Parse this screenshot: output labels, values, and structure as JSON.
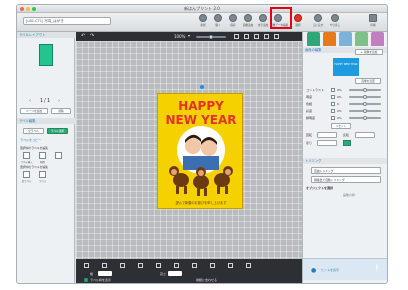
{
  "window": {
    "title": "新はんプリント 2.0",
    "document_name": "[LB1-CT1] 写真_はがき"
  },
  "toolbar": {
    "buttons": [
      {
        "label": "新規"
      },
      {
        "label": "開く"
      },
      {
        "label": "保存"
      },
      {
        "label": "画像追加"
      },
      {
        "label": "文字追加"
      },
      {
        "label": "画像データ編集"
      },
      {
        "label": "選択"
      },
      {
        "label": "元に戻す"
      },
      {
        "label": "やり直し"
      },
      {
        "label": "印刷"
      }
    ]
  },
  "left_panel": {
    "layout_header": "ラベルレイアウト",
    "pager": {
      "prev": "‹",
      "current": "1",
      "sep": "/",
      "total": "1",
      "next": "›"
    },
    "add_page": "ページを追加",
    "delete_page": "削除",
    "label_section": "ラベル編集",
    "all_labels": "全ラベル",
    "label_select": "ラベル選択",
    "label_copy": "ラベルをコピー",
    "selected_label_header": "選択中のラベルを編集",
    "selected_icons": [
      "ラベル挿入",
      "削除"
    ],
    "all_labels_header": "選択中のラベルを編集",
    "all_icons": [
      "全ラベル",
      "ラベル"
    ]
  },
  "canvas": {
    "zoom": "100%",
    "card": {
      "line1": "HAPPY",
      "line2": "NEW YEAR",
      "greeting": "謹んで新春のお慶びを申し上げます"
    },
    "label_info": "ラベル枠を表示",
    "paper_info": "用紙に合わせる",
    "width_label": "幅",
    "height_label": "高さ"
  },
  "right_panel": {
    "tabs": [
      "レイアウト",
      "画像",
      "文字",
      "配置",
      "描画"
    ],
    "image_edit_header": "画像の編集",
    "add_image_button": "+ 画像を追加",
    "thumb_text": "HAPPY NEW YEAR",
    "change_image_button": "画像を変更",
    "rows": [
      {
        "label": "コントラスト",
        "value": "0%"
      },
      {
        "label": "明度",
        "value": "0%"
      },
      {
        "label": "色相",
        "value": "0"
      },
      {
        "label": "彩度",
        "value": "0%"
      },
      {
        "label": "鮮明度",
        "value": "0%"
      }
    ],
    "reset_button": "リセット",
    "rotate_label": "回転",
    "flip_label": "反転",
    "fill_label": "塗り",
    "trimming_header": "トリミング",
    "trim_button_1": "自由トリミング",
    "trim_button_2": "顔検出で自動トリミング",
    "object_header": "オブジェクトを選択",
    "frame_label": "画像の枠",
    "hint": "ヒントを表示"
  },
  "colors": {
    "accent_green": "#2fa77a",
    "card_yellow": "#f6d100",
    "card_red": "#e4322b",
    "highlight_red": "#e60012",
    "canvas_gray": "#b9bcbf"
  }
}
